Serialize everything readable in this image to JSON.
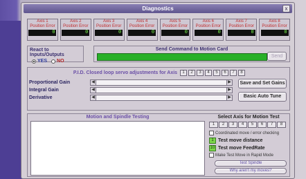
{
  "window": {
    "title": "Diagnostics",
    "close_label": "x"
  },
  "axes": [
    {
      "label": "Axis 1",
      "sublabel": "Position Error",
      "value": "0"
    },
    {
      "label": "Axis 2",
      "sublabel": "Position Error",
      "value": "0"
    },
    {
      "label": "Axis 3",
      "sublabel": "Position Error",
      "value": "0"
    },
    {
      "label": "Axis 4",
      "sublabel": "Position Error",
      "value": "0"
    },
    {
      "label": "Axis 5",
      "sublabel": "Position Error",
      "value": "0"
    },
    {
      "label": "Axis 6",
      "sublabel": "Position Error",
      "value": "0"
    },
    {
      "label": "Axis 7",
      "sublabel": "Position Error",
      "value": "0"
    },
    {
      "label": "Axis 8",
      "sublabel": "Position Error",
      "value": "0"
    }
  ],
  "react": {
    "title": "React to Inputs/Outputs",
    "yes": "YES",
    "no": "NO"
  },
  "send": {
    "title": "Send Command to Motion Card",
    "button": "Send",
    "bar_color": "#28b028"
  },
  "pid": {
    "title": "P.I.D.  Closed loop servo adjustments for Axis",
    "axis_numbers": [
      "1",
      "2",
      "3",
      "4",
      "5",
      "6",
      "7",
      "8"
    ],
    "proportional": "Proportional Gain",
    "integral": "Integral Gain",
    "derivative": "Derivative",
    "save_button": "Save and Set Gains",
    "autotune_button": "Basic Auto Tune"
  },
  "motion": {
    "title": "Motion and Spindle Testing",
    "select_axis": "Select Axis for Motion Test",
    "axis_numbers": [
      "1",
      "2",
      "3",
      "4",
      "5",
      "6",
      "7",
      "8"
    ],
    "coordinated": "Coordinated move / error checking",
    "distance_value": "1",
    "distance_label": "Test move distance",
    "feedrate_value": "10",
    "feedrate_label": "Test move FeedRate",
    "rapid": "Make Test Move in Rapid Mode",
    "test_spindle": "Test Spindle",
    "why_not": "Why aren't my moves?"
  }
}
